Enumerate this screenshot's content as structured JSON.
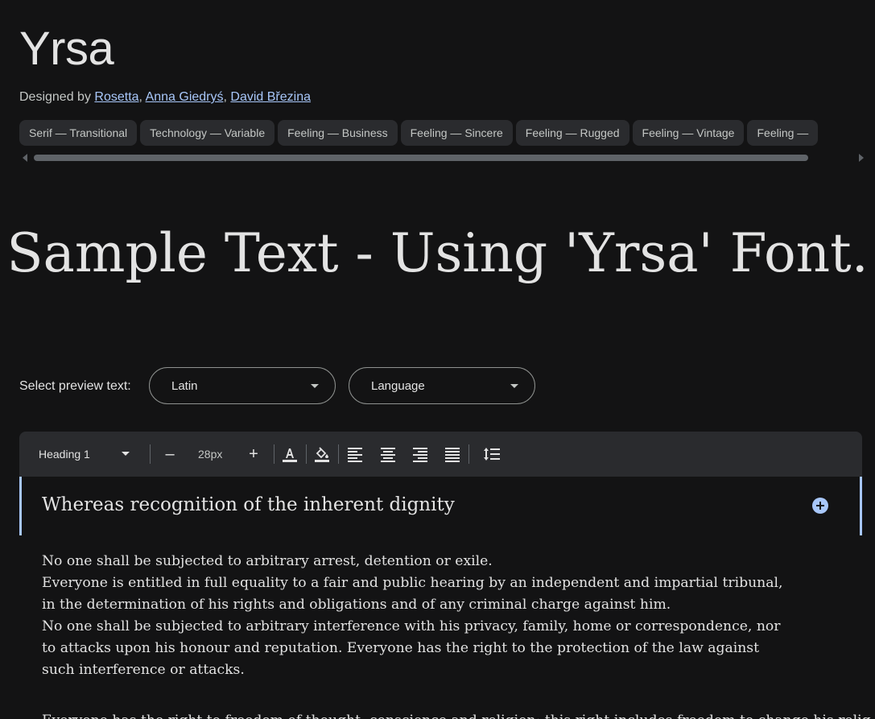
{
  "font": {
    "name": "Yrsa",
    "designed_by_label": "Designed by",
    "designers": [
      "Rosetta",
      "Anna Giedryś",
      "David Březina"
    ],
    "separator": ","
  },
  "tags": [
    "Serif — Transitional",
    "Technology — Variable",
    "Feeling — Business",
    "Feeling — Sincere",
    "Feeling — Rugged",
    "Feeling — Vintage",
    "Feeling —"
  ],
  "hero": {
    "sample_text": "Sample Text - Using 'Yrsa' Font."
  },
  "preview": {
    "label": "Select preview text:",
    "script_select": "Latin",
    "language_select": "Language"
  },
  "toolbar": {
    "style_select": "Heading 1",
    "decrease_label": "–",
    "font_size": "28px",
    "increase_label": "+"
  },
  "editor": {
    "heading": "Whereas recognition of the inherent dignity",
    "paragraph_lines": [
      "No one shall be subjected to arbitrary arrest, detention or exile.",
      "Everyone is entitled in full equality to a fair and public hearing by an independent and impartial tribunal,",
      "in the determination of his rights and obligations and of any criminal charge against him.",
      "No one shall be subjected to arbitrary interference with his privacy, family, home or correspondence, nor",
      "to attacks upon his honour and reputation. Everyone has the right to the protection of the law against",
      "such interference or attacks."
    ],
    "next_paragraph_partial": "Everyone has the right to freedom of thought, conscience and religion; this right includes freedom to change his religion or belief"
  },
  "colors": {
    "background": "#131314",
    "chip_bg": "#2a2b2e",
    "link": "#a8c7fa",
    "accent": "#a8c7fa"
  }
}
